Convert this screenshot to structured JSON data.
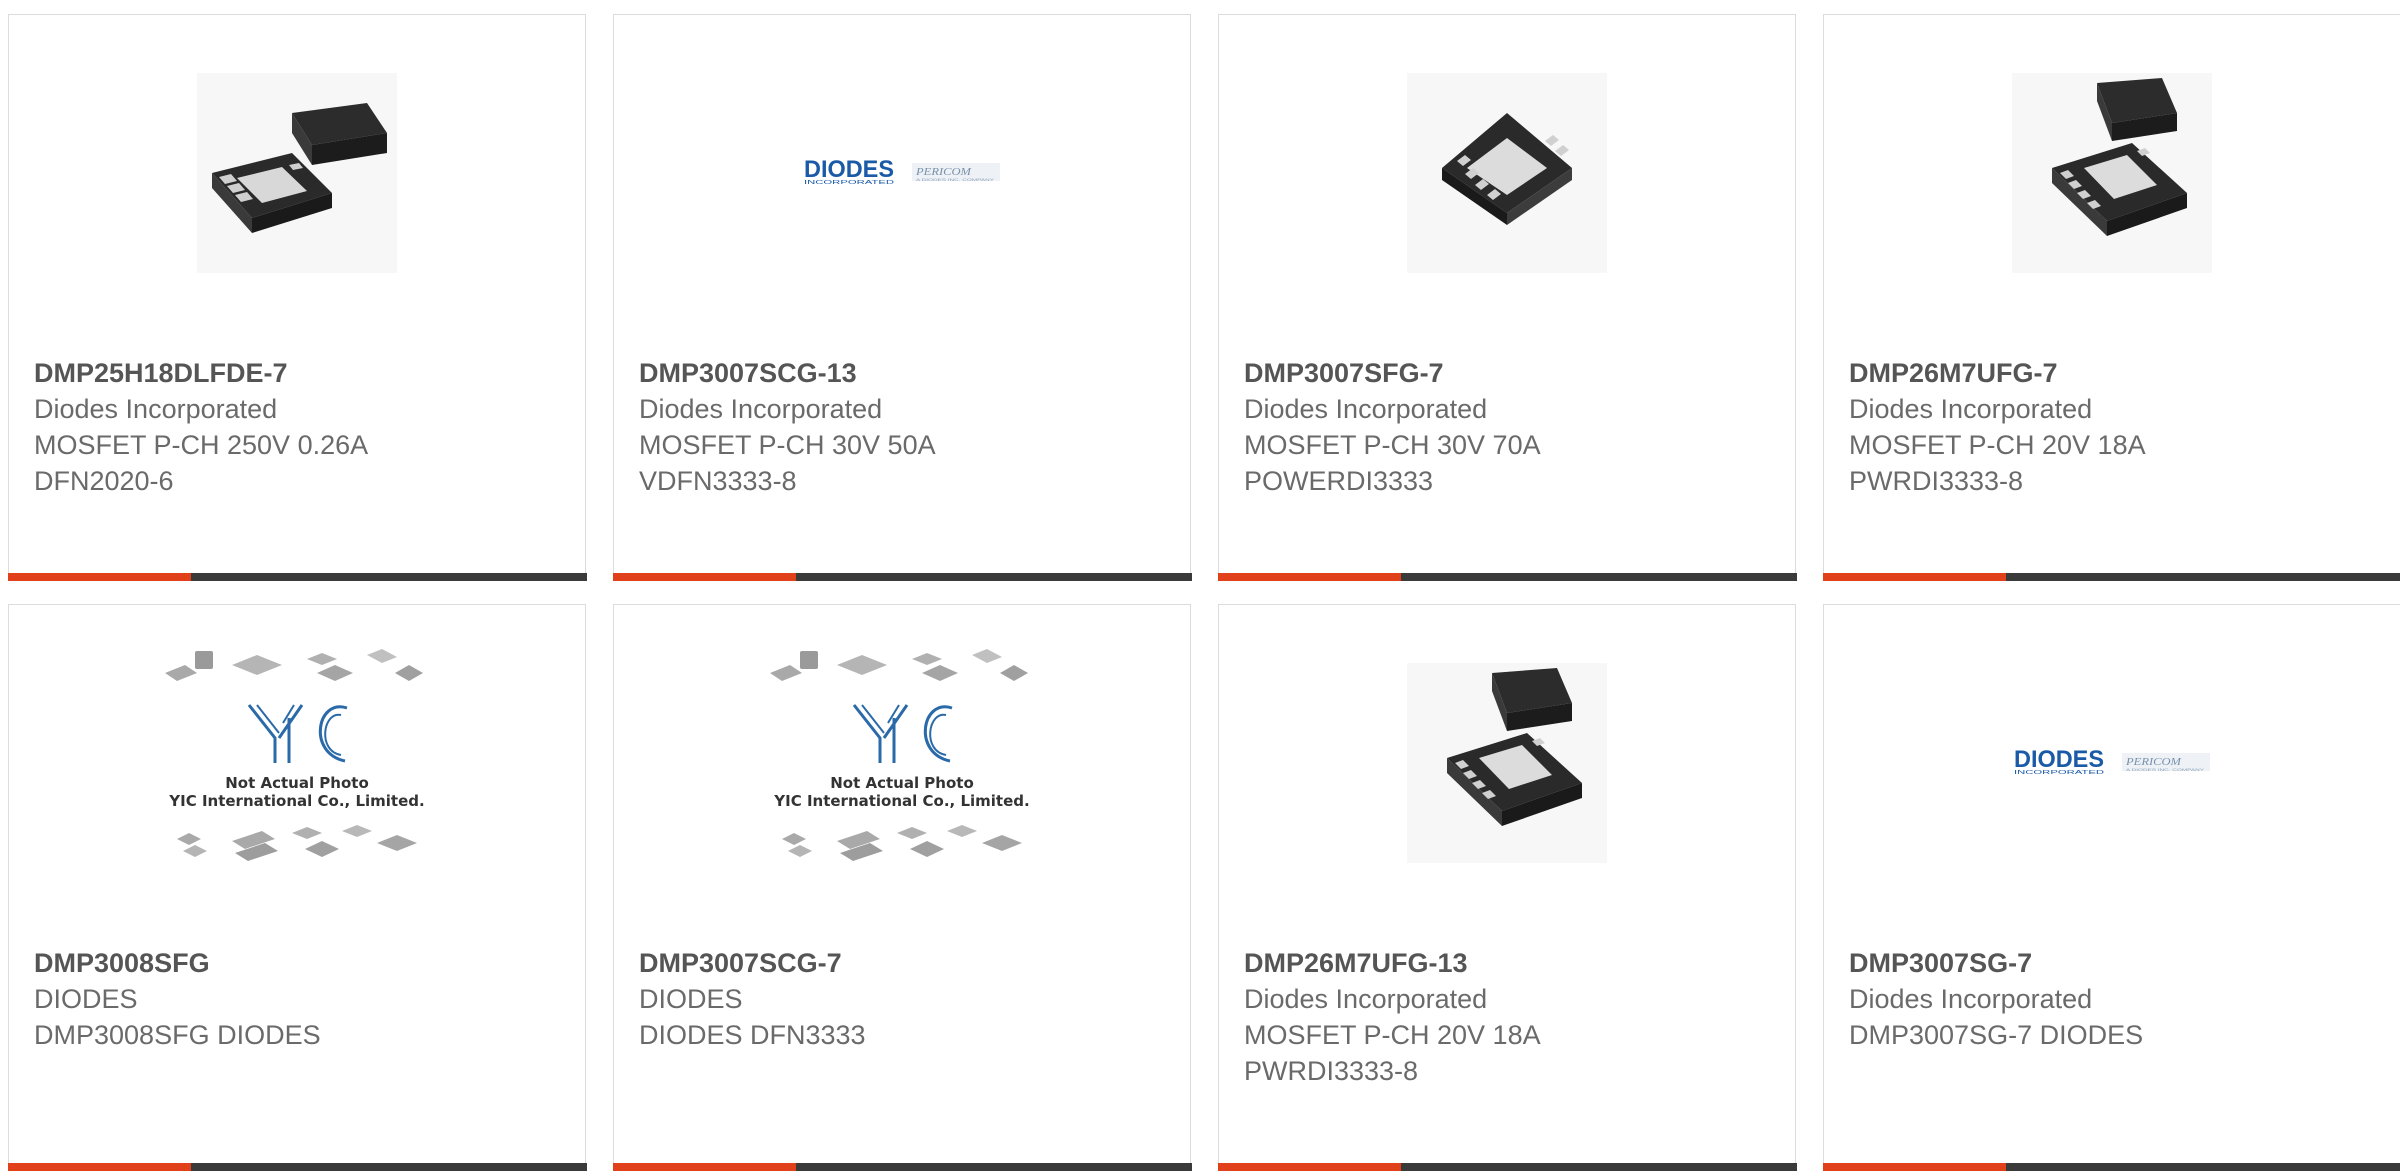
{
  "products": [
    {
      "part_number": "DMP25H18DLFDE-7",
      "manufacturer": "Diodes Incorporated",
      "lines": [
        "MOSFET P-CH 250V 0.26A",
        "DFN2020-6"
      ],
      "image": "dfn-package-photo"
    },
    {
      "part_number": "DMP3007SCG-13",
      "manufacturer": "Diodes Incorporated",
      "lines": [
        "MOSFET P-CH 30V 50A",
        "VDFN3333-8"
      ],
      "image": "diodes-pericom-logo"
    },
    {
      "part_number": "DMP3007SFG-7",
      "manufacturer": "Diodes Incorporated",
      "lines": [
        "MOSFET P-CH 30V 70A",
        "POWERDI3333"
      ],
      "image": "powerdi-package-photo"
    },
    {
      "part_number": "DMP26M7UFG-7",
      "manufacturer": "Diodes Incorporated",
      "lines": [
        "MOSFET P-CH 20V 18A",
        "PWRDI3333-8"
      ],
      "image": "pwrdi-two-package-photo"
    },
    {
      "part_number": "DMP3008SFG",
      "manufacturer": "DIODES",
      "lines": [
        "DMP3008SFG DIODES"
      ],
      "image": "yic-placeholder"
    },
    {
      "part_number": "DMP3007SCG-7",
      "manufacturer": "DIODES",
      "lines": [
        "DIODES DFN3333"
      ],
      "image": "yic-placeholder"
    },
    {
      "part_number": "DMP26M7UFG-13",
      "manufacturer": "Diodes Incorporated",
      "lines": [
        "MOSFET P-CH 20V 18A",
        "PWRDI3333-8"
      ],
      "image": "pwrdi-two-package-photo"
    },
    {
      "part_number": "DMP3007SG-7",
      "manufacturer": "Diodes Incorporated",
      "lines": [
        "DMP3007SG-7 DIODES"
      ],
      "image": "diodes-pericom-logo"
    }
  ],
  "logo_text": {
    "diodes": "DIODES",
    "diodes_sub": "INCORPORATED",
    "pericom": "PERICOM",
    "pericom_sub": "A DIODES INC. COMPANY"
  },
  "yic_text": {
    "logo": "YIC",
    "caption_1": "Not Actual Photo",
    "caption_2": "YIC International Co., Limited."
  },
  "colors": {
    "accent_bar": "#e0401a",
    "bar": "#3a3a3a",
    "card_border": "#dcdcdc",
    "part_number": "#555555",
    "text": "#6a6a6a",
    "diodes_blue": "#1b5aa6"
  }
}
